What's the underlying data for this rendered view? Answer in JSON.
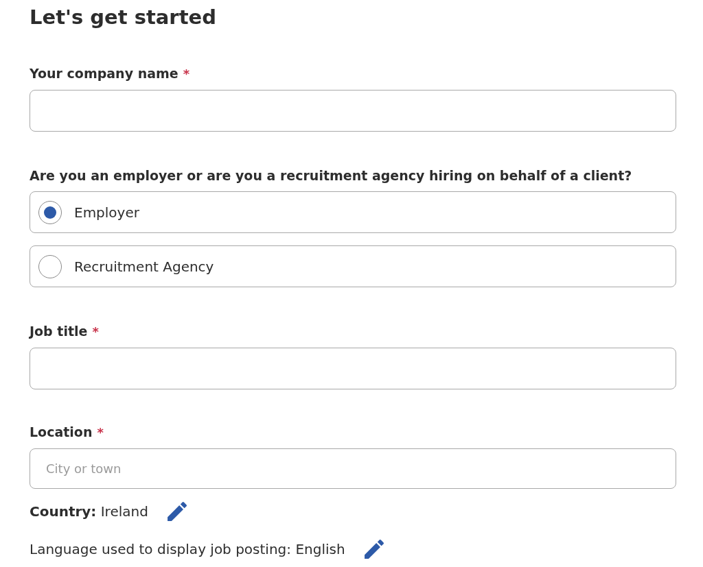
{
  "heading": "Let's get started",
  "fields": [
    {
      "kind": "text",
      "label": "Your company name",
      "required_mark": "*"
    },
    {
      "kind": "radio",
      "label": "Are you an employer or are you a recruitment agency hiring on behalf of a client?",
      "options": [
        {
          "label": "Employer",
          "selected": true
        },
        {
          "label": "Recruitment Agency",
          "selected": false
        }
      ]
    },
    {
      "kind": "text",
      "label": "Job title",
      "required_mark": "*"
    },
    {
      "kind": "text",
      "label": "Location",
      "required_mark": "*",
      "placeholder": "City or town"
    }
  ],
  "details": [
    {
      "text": "**Country:** Ireland",
      "editable": true
    },
    {
      "text": "Language used to display job posting: English",
      "editable": true
    }
  ]
}
